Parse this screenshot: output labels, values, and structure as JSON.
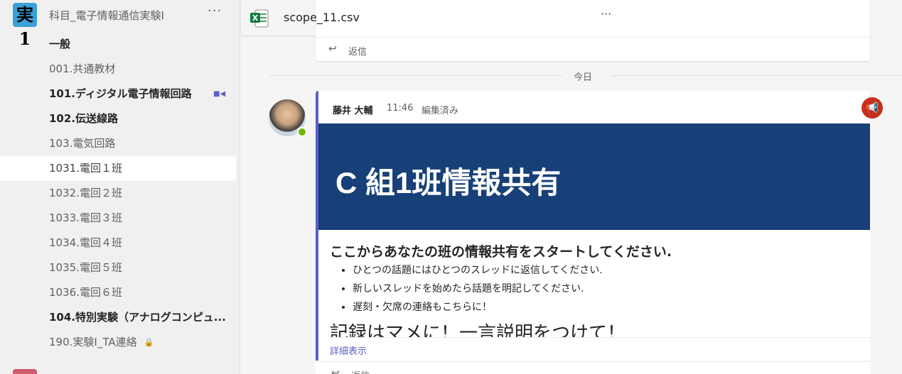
{
  "sidebar": {
    "team": {
      "avatar_glyph": "実1",
      "name": "科目_電子情報通信実験Ⅰ",
      "more": "···"
    },
    "channels": [
      {
        "label": "一般",
        "bold": true
      },
      {
        "label": "001.共通教材",
        "bold": false
      },
      {
        "label": "101.ディジタル電子情報回路",
        "bold": true,
        "icon": "video-camera-icon"
      },
      {
        "label": "102.伝送線路",
        "bold": true
      },
      {
        "label": "103.電気回路",
        "bold": false
      },
      {
        "label": "1031.電回１班",
        "bold": false,
        "selected": true
      },
      {
        "label": "1032.電回２班",
        "bold": false
      },
      {
        "label": "1033.電回３班",
        "bold": false
      },
      {
        "label": "1034.電回４班",
        "bold": false
      },
      {
        "label": "1035.電回５班",
        "bold": false
      },
      {
        "label": "1036.電回６班",
        "bold": false
      },
      {
        "label": "104.特別実験（アナログコンピュ...",
        "bold": true
      },
      {
        "label": "190.実験Ⅰ_TA連絡",
        "bold": false,
        "icon": "lock-icon"
      }
    ]
  },
  "main": {
    "previous": {
      "file_name": "scope_11.csv",
      "file_more": "···",
      "reply_label": "返信"
    },
    "date_divider": "今日",
    "post": {
      "author": "藤井 大輔",
      "time": "11:46",
      "edited": "編集済み",
      "banner_title": "C 組1班情報共有",
      "heading": "ここからあなたの班の情報共有をスタートしてください.",
      "bullets": [
        "ひとつの話題にはひとつのスレッドに返信してください.",
        "新しいスレッドを始めたら話題を明記してください.",
        "遅刻・欠席の連絡もこちらに！"
      ],
      "cutoff_text": "記録はマメに！一言説明をつけて！",
      "more_link": "詳細表示",
      "reply_label": "返信"
    }
  },
  "colors": {
    "accent": "#5b5fc7",
    "banner": "#173f78",
    "announce": "#c4321f",
    "presence": "#6bb700",
    "excel": "#107c41"
  }
}
